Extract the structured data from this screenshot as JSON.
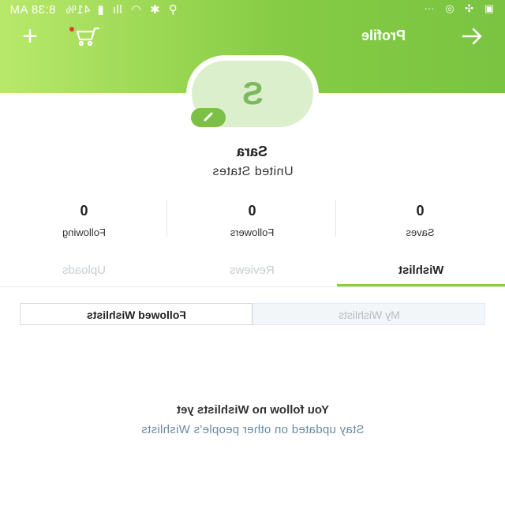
{
  "status_bar": {
    "time": "8:38 AM",
    "battery": "41%",
    "icons": [
      "gallery-icon",
      "fan-icon",
      "sync-icon",
      "more-icon",
      "location-icon",
      "bluetooth-icon",
      "wifi-icon",
      "signal-icon",
      "battery-icon"
    ]
  },
  "header": {
    "title": "Profile",
    "accent_color": "#86cc44"
  },
  "profile": {
    "avatar_initial": "S",
    "name": "Sara",
    "country": "United States"
  },
  "stats": [
    {
      "value": "0",
      "label": "Following"
    },
    {
      "value": "0",
      "label": "Followers"
    },
    {
      "value": "0",
      "label": "Saves"
    }
  ],
  "tabs": [
    {
      "label": "Uploads",
      "active": false
    },
    {
      "label": "Reviews",
      "active": false
    },
    {
      "label": "Wishlist",
      "active": true
    }
  ],
  "segments": {
    "followed": "Followed Wishlists",
    "mine": "My Wishlists"
  },
  "empty_state": {
    "title": "You follow no Wishlists yet",
    "subtitle": "Stay updated on other people's Wishlists"
  }
}
